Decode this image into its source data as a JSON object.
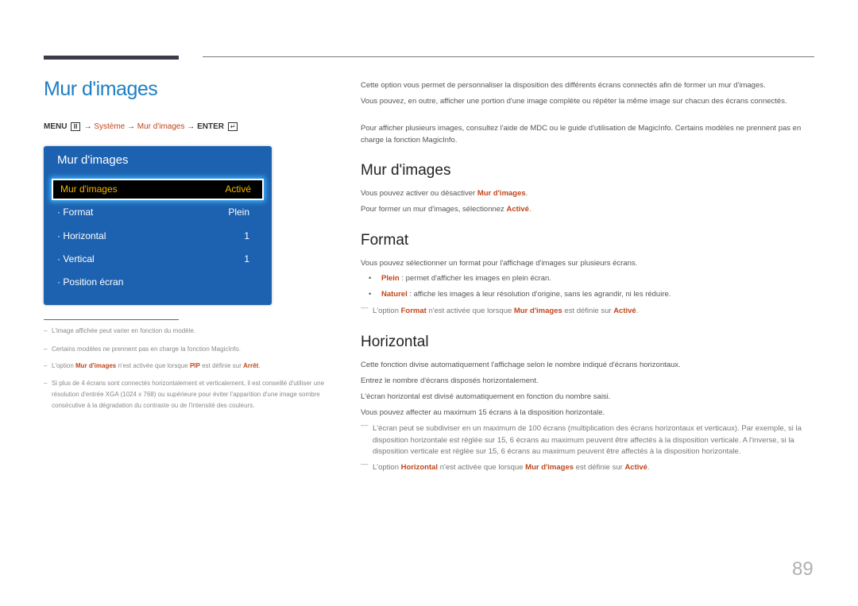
{
  "page_title": "Mur d'images",
  "menu_path": {
    "menu": "MENU",
    "menu_icon": "menu-icon",
    "arrow": "→",
    "system": "Système",
    "item": "Mur d'images",
    "enter": "ENTER",
    "enter_icon": "enter-icon"
  },
  "osd": {
    "title": "Mur d'images",
    "selected": {
      "label": "Mur d'images",
      "value": "Activé"
    },
    "rows": [
      {
        "label": "· Format",
        "value": "Plein"
      },
      {
        "label": "· Horizontal",
        "value": "1"
      },
      {
        "label": "· Vertical",
        "value": "1"
      },
      {
        "label": "· Position écran",
        "value": ""
      }
    ]
  },
  "footnotes": {
    "dash": "–",
    "f1": "L'image affichée peut varier en fonction du modèle.",
    "f2": "Certains modèles ne prennent pas en charge la fonction MagicInfo.",
    "f3": {
      "a": "L'option ",
      "b": "Mur d'images",
      "c": " n'est activée que lorsque ",
      "d": "PIP",
      "e": " est définie sur ",
      "f": "Arrêt",
      "g": "."
    },
    "f4": "Si plus de 4 écrans sont connectés horizontalement et verticalement, il est conseillé d'utiliser une résolution d'entrée XGA (1024 x 768) ou supérieure pour éviter l'apparition d'une image sombre consécutive à la dégradation du contraste ou de l'intensité des couleurs."
  },
  "intro": {
    "p1": "Cette option vous permet de personnaliser la disposition des différents écrans connectés afin de former un mur d'images.",
    "p2": "Vous pouvez, en outre, afficher une portion d'une image complète ou répéter la même image sur chacun des écrans connectés.",
    "p3": "Pour afficher plusieurs images, consultez l'aide de MDC ou le guide d'utilisation de MagicInfo. Certains modèles ne prennent pas en charge la fonction MagicInfo."
  },
  "section_mur": {
    "heading": "Mur d'images",
    "p1": {
      "a": "Vous pouvez activer ou désactiver ",
      "b": "Mur d'images",
      "c": "."
    },
    "p2": {
      "a": "Pour former un mur d'images, sélectionnez ",
      "b": "Activé",
      "c": "."
    }
  },
  "section_format": {
    "heading": "Format",
    "p1": "Vous pouvez sélectionner un format pour l'affichage d'images sur plusieurs écrans.",
    "bullet": "•",
    "b1": {
      "a": "Plein",
      "b": " : permet d'afficher les images en plein écran."
    },
    "b2": {
      "a": "Naturel",
      "b": " : affiche les images à leur résolution d'origine, sans les agrandir, ni les réduire."
    },
    "note": {
      "mark": "—",
      "a": "L'option ",
      "b": "Format",
      "c": " n'est activée que lorsque ",
      "d": "Mur d'images",
      "e": " est définie sur ",
      "f": "Activé",
      "g": "."
    }
  },
  "section_horizontal": {
    "heading": "Horizontal",
    "p1": "Cette fonction divise automatiquement l'affichage selon le nombre indiqué d'écrans horizontaux.",
    "p2": "Entrez le nombre d'écrans disposés horizontalement.",
    "p3": "L'écran horizontal est divisé automatiquement en fonction du nombre saisi.",
    "p4": "Vous pouvez affecter au maximum 15 écrans à la disposition horizontale.",
    "note1": {
      "mark": "—",
      "text": "L'écran peut se subdiviser en un maximum de 100 écrans (multiplication des écrans horizontaux et verticaux). Par exemple, si la disposition horizontale est réglée sur 15, 6 écrans au maximum peuvent être affectés à la disposition verticale. A l'inverse, si la disposition verticale est réglée sur 15, 6 écrans au maximum peuvent être affectés à la disposition horizontale."
    },
    "note2": {
      "mark": "—",
      "a": "L'option ",
      "b": "Horizontal",
      "c": " n'est activée que lorsque ",
      "d": "Mur d'images",
      "e": " est définie sur ",
      "f": "Activé",
      "g": "."
    }
  },
  "page_number": "89"
}
